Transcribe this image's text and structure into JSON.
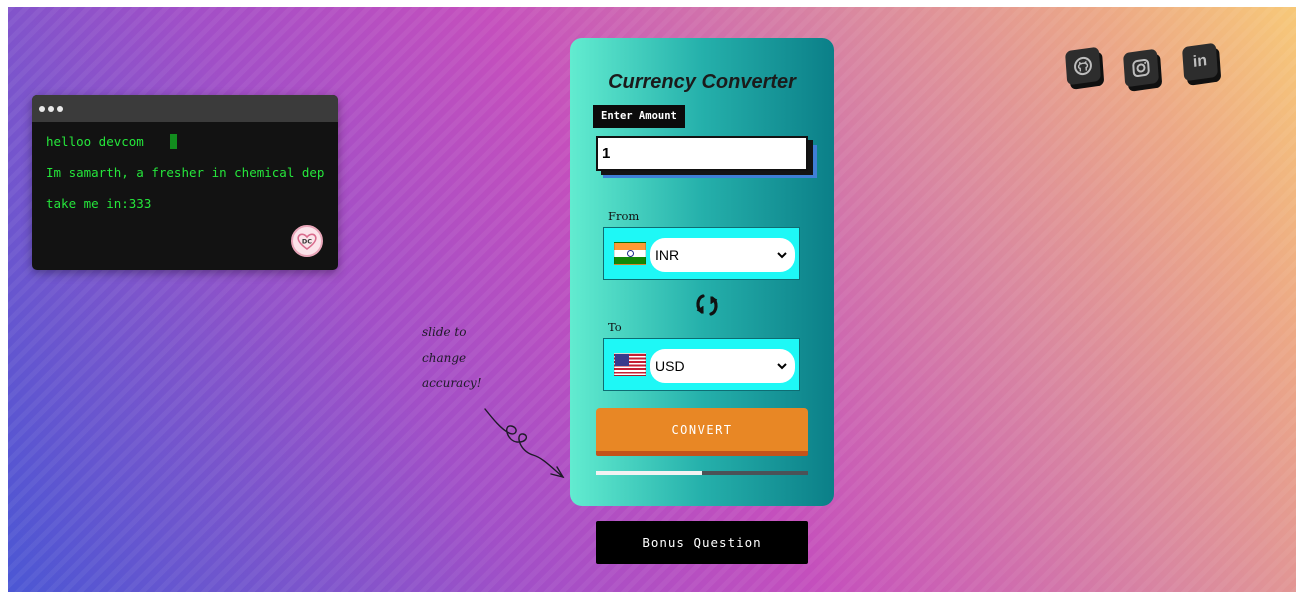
{
  "terminal": {
    "lines": [
      "helloo devcom",
      "Im samarth, a fresher in chemical dep",
      "take me in:333"
    ],
    "logo_text": "DC"
  },
  "social_icons": [
    "github-icon",
    "instagram-icon",
    "linkedin-icon"
  ],
  "social_labels": {
    "linkedin": "in"
  },
  "note": {
    "lines": [
      "slide to",
      "change",
      "accuracy!"
    ]
  },
  "converter": {
    "title": "Currency Converter",
    "amount_label": "Enter Amount",
    "amount_value": "1",
    "from_label": "From",
    "from_currency": "INR",
    "to_label": "To",
    "to_currency": "USD",
    "convert_label": "CONVERT",
    "accuracy_slider_fraction": 0.5
  },
  "bonus_label": "Bonus Question",
  "colors": {
    "card_start": "#62ecd0",
    "card_end": "#0b7f88",
    "convert_button": "#e88725",
    "select_background": "#1ef8f6",
    "terminal_text": "#25e63b"
  }
}
